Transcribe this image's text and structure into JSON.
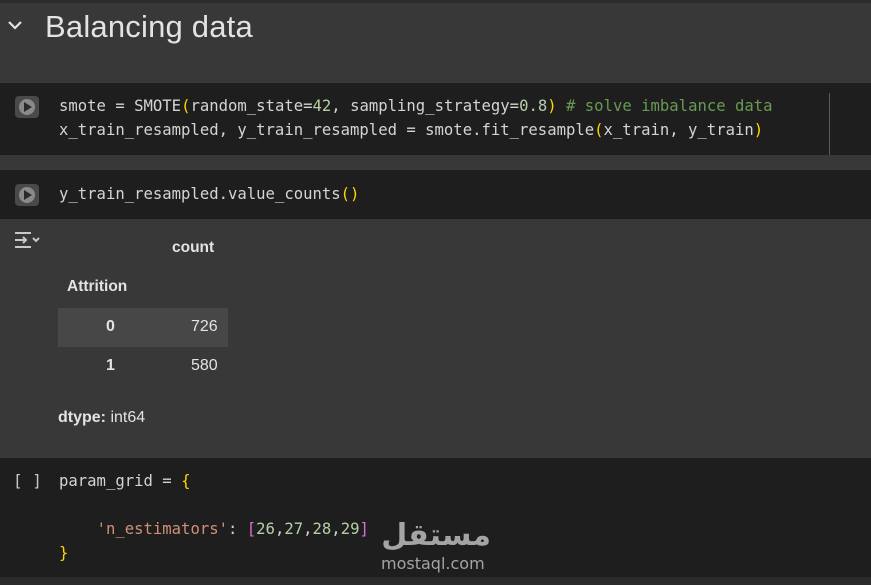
{
  "section": {
    "title": "Balancing data",
    "collapse_icon": "chevron-down-icon"
  },
  "cell1": {
    "run_icon": "play-icon",
    "line1": {
      "a": "smote = SMOTE",
      "p1": "(",
      "b": "random_state=",
      "n1": "42",
      "c": ", sampling_strategy=",
      "n2": "0.8",
      "p2": ")",
      "sp": " ",
      "comment": "# solve imbalance data"
    },
    "line2": {
      "a": "x_train_resampled, y_train_resampled = smote.fit_resample",
      "p1": "(",
      "b": "x_train, y_train",
      "p2": ")"
    }
  },
  "cell2": {
    "run_icon": "play-icon",
    "line1": {
      "a": "y_train_resampled.value_counts",
      "p": "()"
    }
  },
  "output": {
    "icon": "output-toggle-icon",
    "column_header": "count",
    "index_header": "Attrition",
    "rows": [
      {
        "index": "0",
        "count": "726"
      },
      {
        "index": "1",
        "count": "580"
      }
    ],
    "dtype_label": "dtype:",
    "dtype_value": " int64"
  },
  "cell3": {
    "brackets": "[ ]",
    "line1": {
      "a": "param_grid = ",
      "brace": "{"
    },
    "line2": {
      "indent": "    ",
      "key": "'n_estimators'",
      "colon": ": ",
      "lb": "[",
      "v1": "26",
      "c1": ",",
      "v2": "27",
      "c2": ",",
      "v3": "28",
      "c3": ",",
      "v4": "29",
      "rb": "]"
    },
    "line3": {
      "brace": "}"
    }
  },
  "watermark": {
    "arabic": "مستقل",
    "latin": "mostaql.com"
  },
  "colors": {
    "background": "#383838",
    "code_bg": "#1e1e1e",
    "paren": "#ffd700",
    "number": "#b5cea8",
    "comment": "#6a9955",
    "string": "#ce9178",
    "bracket": "#da70d6"
  }
}
